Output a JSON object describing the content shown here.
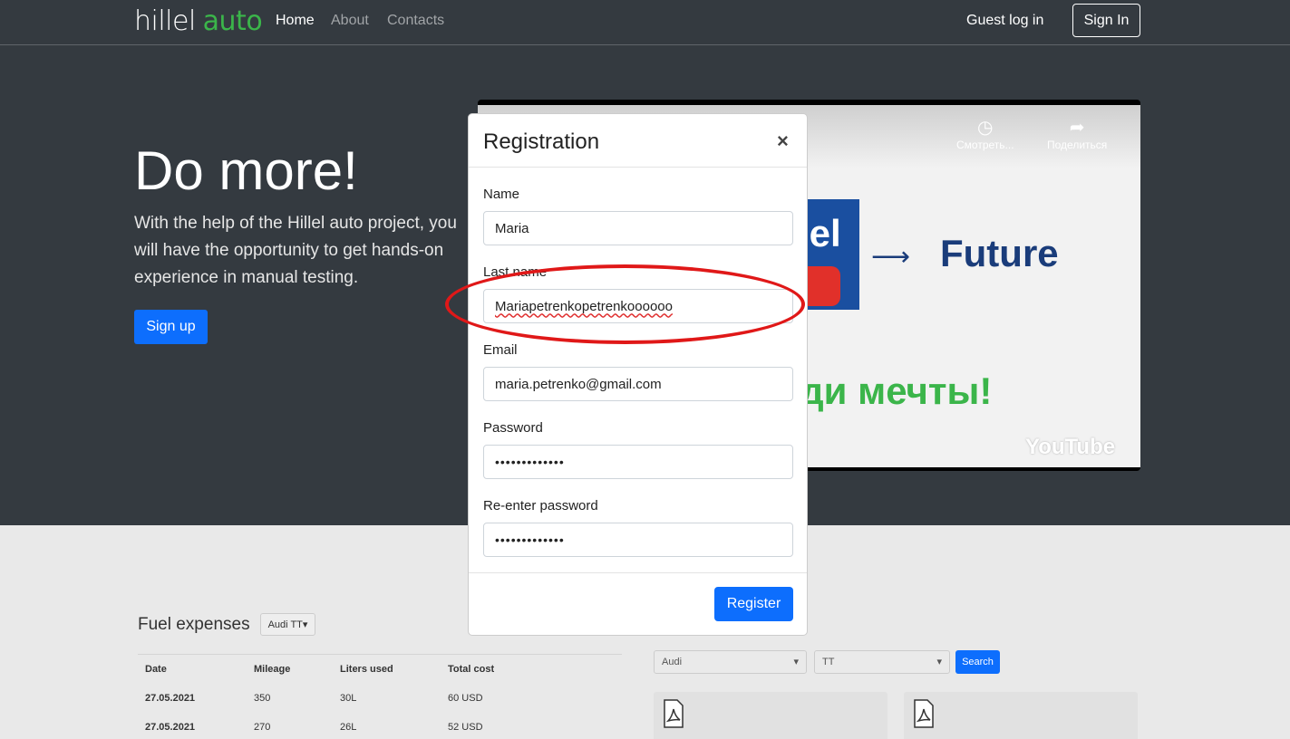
{
  "header": {
    "logo_main": "hillel",
    "logo_accent": "auto",
    "nav": [
      "Home",
      "About",
      "Contacts"
    ],
    "guest_login": "Guest log in",
    "sign_in": "Sign In"
  },
  "hero": {
    "title": "Do more!",
    "text": "With the help of the Hillel auto project, you will have the opportunity to get hands-on experience in manual testing.",
    "signup": "Sign up"
  },
  "video": {
    "watch_later": "Смотреть...",
    "share": "Поделиться",
    "logo_text": "lel",
    "future": "Future",
    "dream": "ди мечты!",
    "brand": "YouTube"
  },
  "fuel": {
    "title": "Fuel expenses",
    "car_select": "Audi TT",
    "columns": [
      "Date",
      "Mileage",
      "Liters used",
      "Total cost"
    ],
    "rows": [
      [
        "27.05.2021",
        "350",
        "30L",
        "60 USD"
      ],
      [
        "27.05.2021",
        "270",
        "26L",
        "52 USD"
      ]
    ]
  },
  "filters": {
    "brand": "Audi",
    "model": "TT",
    "search": "Search"
  },
  "modal": {
    "title": "Registration",
    "close": "×",
    "name_label": "Name",
    "name_value": "Maria",
    "last_name_label": "Last name",
    "last_name_value": "Mariapetrenkopetrenkoooooo",
    "email_label": "Email",
    "email_value": "maria.petrenko@gmail.com",
    "password_label": "Password",
    "password_value": "•••••••••••••",
    "repassword_label": "Re-enter password",
    "repassword_value": "•••••••••••••",
    "register": "Register"
  },
  "colors": {
    "header_bg": "#343a40",
    "primary": "#0d6efd",
    "logo_green": "#3bb54a",
    "annotation": "#e01818"
  }
}
